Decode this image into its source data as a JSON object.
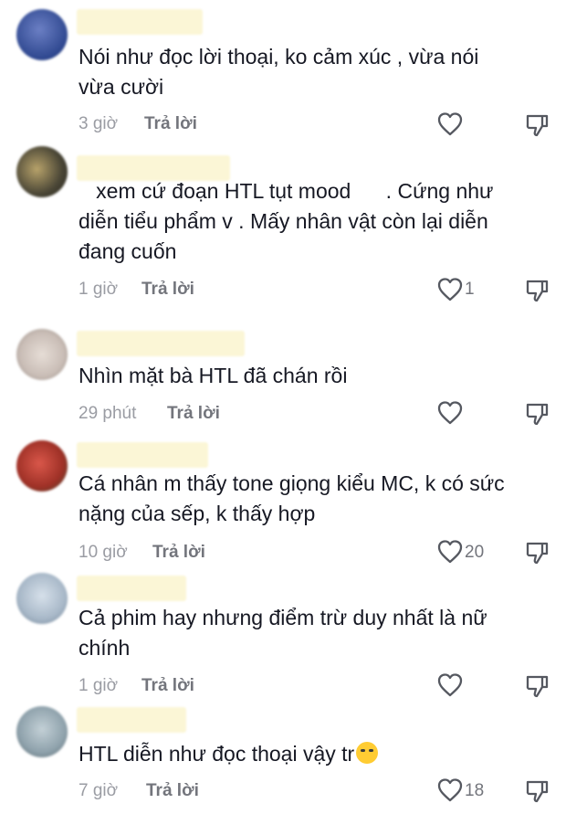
{
  "comments": [
    {
      "text": "Nói như đọc lời thoại, ko cảm xúc , vừa nói\nvừa cười",
      "time": "3 giờ",
      "reply": "Trả lời",
      "likes": "",
      "avatar_color": "#3c5aa8"
    },
    {
      "text": "   xem cứ đoạn HTL tụt mood      . Cứng như\ndiễn tiểu phẩm v . Mấy nhân vật còn lại diễn\nđang cuốn",
      "time": "1 giờ",
      "reply": "Trả lời",
      "likes": "1",
      "avatar_color": "#4a4636"
    },
    {
      "text": "Nhìn mặt bà HTL đã chán rồi",
      "time": "29 phút",
      "reply": "Trả lời",
      "likes": "",
      "avatar_color": "#c9bdb6"
    },
    {
      "text": "Cá nhân m thấy tone giọng kiểu MC, k có sức\nnặng của sếp, k thấy hợp",
      "time": "10 giờ",
      "reply": "Trả lời",
      "likes": "20",
      "avatar_color": "#9e3026"
    },
    {
      "text": "Cả phim hay nhưng điểm trừ duy nhất là nữ\nchính",
      "time": "1 giờ",
      "reply": "Trả lời",
      "likes": "",
      "avatar_color": "#a8b8c8"
    },
    {
      "text": "HTL diễn như đọc thoại vậy tr",
      "time": "7 giờ",
      "reply": "Trả lời",
      "likes": "18",
      "avatar_color": "#8fa2ac"
    }
  ],
  "icons": {
    "like": "heart-outline-icon",
    "dislike": "thumbs-down-icon",
    "emoji": "crying-face-emoji"
  }
}
